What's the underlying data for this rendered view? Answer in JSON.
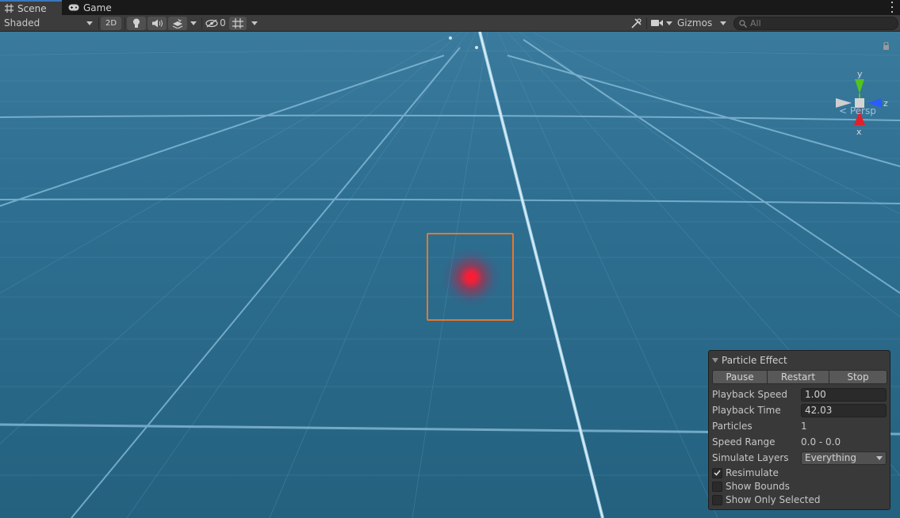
{
  "tabs": [
    {
      "label": "Scene",
      "icon": "grid-icon"
    },
    {
      "label": "Game",
      "icon": "gamepad-icon"
    }
  ],
  "toolbar": {
    "draw_mode": "Shaded",
    "mode_2d": "2D",
    "hidden_count": "0",
    "gizmos_label": "Gizmos",
    "search_placeholder": "All"
  },
  "gizmo": {
    "axis_y": "y",
    "axis_z": "z",
    "axis_x": "x",
    "projection": "< Persp",
    "colors": {
      "x": "#e0202a",
      "y": "#52c41e",
      "z": "#2a5cff"
    }
  },
  "particle_effect": {
    "title": "Particle Effect",
    "buttons": {
      "pause": "Pause",
      "restart": "Restart",
      "stop": "Stop"
    },
    "playback_speed_label": "Playback Speed",
    "playback_speed": "1.00",
    "playback_time_label": "Playback Time",
    "playback_time": "42.03",
    "particles_label": "Particles",
    "particles": "1",
    "speed_range_label": "Speed Range",
    "speed_range": "0.0 - 0.0",
    "simulate_layers_label": "Simulate Layers",
    "simulate_layers": "Everything",
    "resimulate_label": "Resimulate",
    "resimulate": true,
    "show_bounds_label": "Show Bounds",
    "show_bounds": false,
    "show_only_selected_label": "Show Only Selected",
    "show_only_selected": false
  },
  "colors": {
    "accent": "#3a79bb",
    "selection_outline": "#e8772a",
    "particle": "#ff1a2e",
    "scene_bg": "#2a6a8c"
  }
}
